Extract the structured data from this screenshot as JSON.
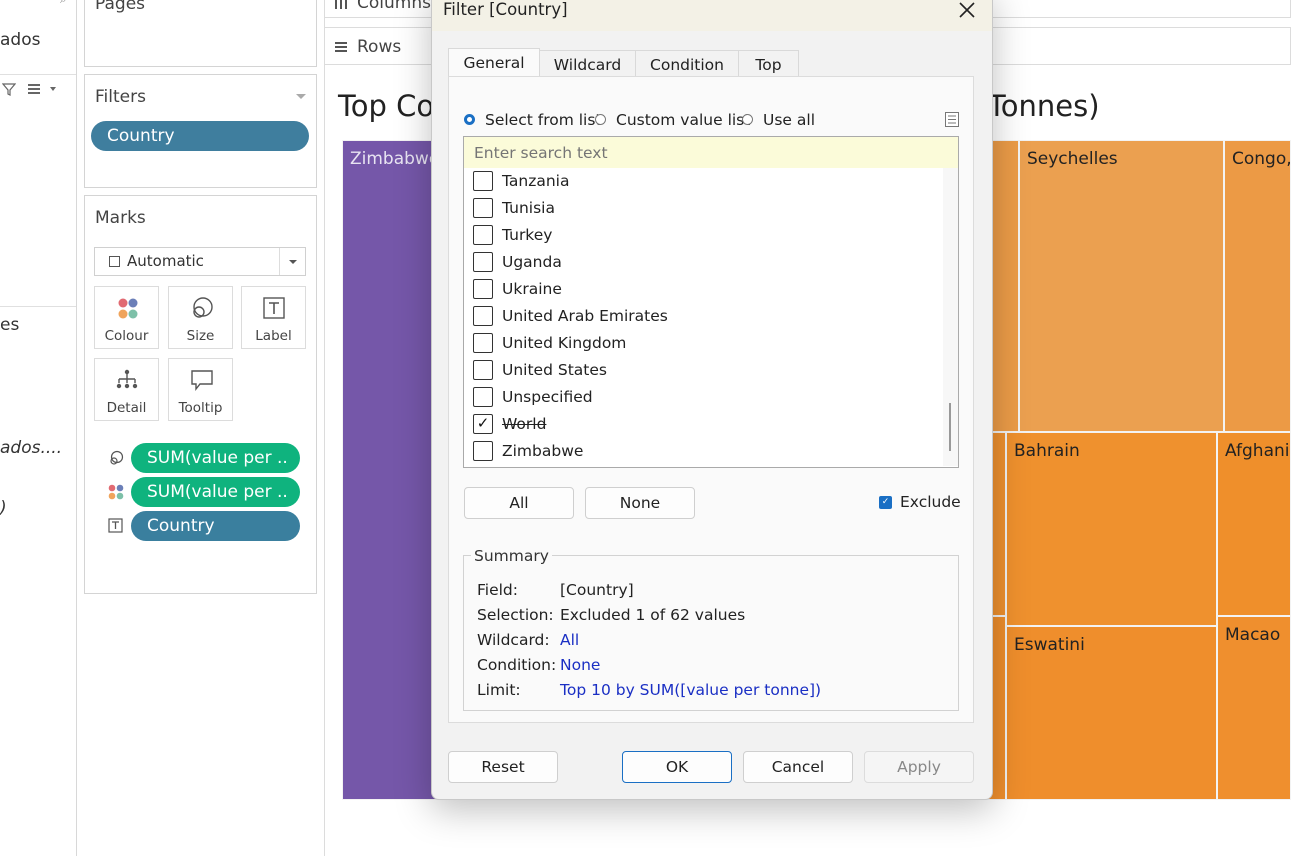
{
  "left_strip": {
    "items": [
      "ados",
      "es",
      "ados....",
      ")"
    ]
  },
  "pages_panel": {
    "title": "Pages"
  },
  "filters_panel": {
    "title": "Filters",
    "pill": "Country"
  },
  "marks_panel": {
    "title": "Marks",
    "mark_type": "Automatic",
    "buttons": [
      {
        "label": "Colour"
      },
      {
        "label": "Size"
      },
      {
        "label": "Label"
      },
      {
        "label": "Detail"
      },
      {
        "label": "Tooltip"
      }
    ],
    "fields": [
      {
        "label": "SUM(value per ..",
        "icon": "size-icon"
      },
      {
        "label": "SUM(value per ..",
        "icon": "colour-icon"
      },
      {
        "label": "Country",
        "icon": "text-label-icon"
      }
    ]
  },
  "shelves": {
    "columns": "Columns",
    "rows": "Rows"
  },
  "viz": {
    "title_left": "Top Co",
    "title_right": "Tonnes)",
    "tiles": [
      {
        "label": "Zimbabwe",
        "color": "#7557a9"
      },
      {
        "label": "Seychelles",
        "color": "#eba050"
      },
      {
        "label": "Congo,",
        "color": "#ec9a45"
      },
      {
        "label": "Bahrain",
        "color": "#ef912e"
      },
      {
        "label": "Afghani",
        "color": "#ef8f2b"
      },
      {
        "label": "Eswatini",
        "color": "#ef8e2c"
      },
      {
        "label": "Macao",
        "color": "#ef8f2e"
      }
    ]
  },
  "dialog": {
    "title": "Filter [Country]",
    "tabs": [
      "General",
      "Wildcard",
      "Condition",
      "Top"
    ],
    "options": [
      "Select from list",
      "Custom value list",
      "Use all"
    ],
    "search_placeholder": "Enter search text",
    "list_items": [
      {
        "label": "Tanzania",
        "checked": false
      },
      {
        "label": "Tunisia",
        "checked": false
      },
      {
        "label": "Turkey",
        "checked": false
      },
      {
        "label": "Uganda",
        "checked": false
      },
      {
        "label": "Ukraine",
        "checked": false
      },
      {
        "label": "United Arab Emirates",
        "checked": false
      },
      {
        "label": "United Kingdom",
        "checked": false
      },
      {
        "label": "United States",
        "checked": false
      },
      {
        "label": "Unspecified",
        "checked": false
      },
      {
        "label": "World",
        "checked": true
      },
      {
        "label": "Zimbabwe",
        "checked": false
      }
    ],
    "all_button": "All",
    "none_button": "None",
    "exclude_label": "Exclude",
    "summary": {
      "title": "Summary",
      "field_label": "Field:",
      "field_value": "[Country]",
      "selection_label": "Selection:",
      "selection_value": "Excluded 1 of 62 values",
      "wildcard_label": "Wildcard:",
      "wildcard_value": "All",
      "condition_label": "Condition:",
      "condition_value": "None",
      "limit_label": "Limit:",
      "limit_value": "Top 10 by SUM([value per tonne])"
    },
    "reset_button": "Reset",
    "ok_button": "OK",
    "cancel_button": "Cancel",
    "apply_button": "Apply"
  },
  "colors": {
    "accent": "#1a6fc4",
    "pill_blue": "#3f7e9e",
    "pill_green": "#0fb37e",
    "purple": "#7557a9",
    "orange": "#ef8f2b"
  }
}
